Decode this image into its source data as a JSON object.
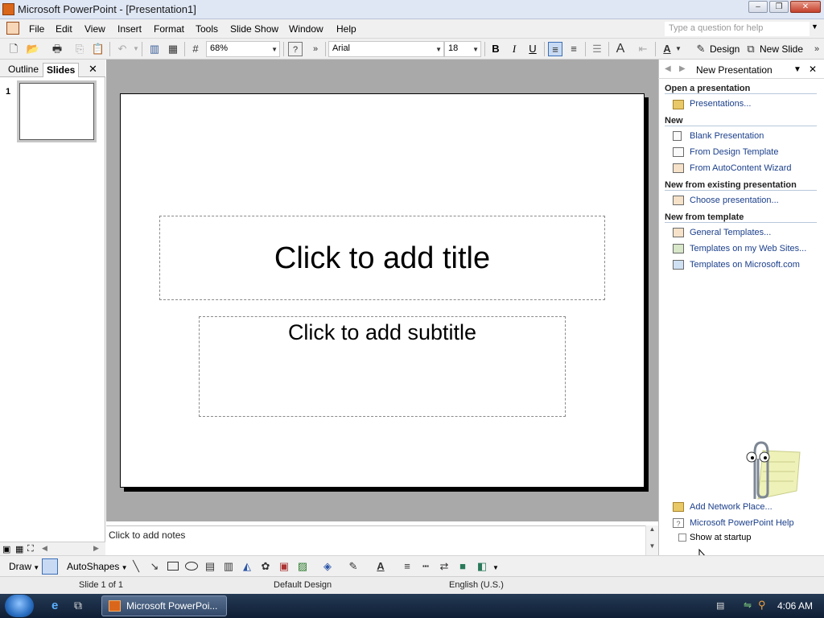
{
  "window": {
    "title": "Microsoft PowerPoint - [Presentation1]",
    "minimize_glyph": "–",
    "restore_glyph": "❐",
    "close_glyph": "✕"
  },
  "menu": {
    "items": [
      "File",
      "Edit",
      "View",
      "Insert",
      "Format",
      "Tools",
      "Slide Show",
      "Window",
      "Help"
    ],
    "ask_placeholder": "Type a question for help"
  },
  "toolbar": {
    "zoom": "68%",
    "font": "Arial",
    "font_size": "18",
    "bold": "B",
    "italic": "I",
    "underline": "U",
    "design_label": "Design",
    "new_slide_label": "New Slide"
  },
  "left_pane": {
    "tabs": [
      "Outline",
      "Slides"
    ],
    "active_tab": "Slides",
    "slide_number": "1"
  },
  "slide": {
    "title_placeholder": "Click to add title",
    "subtitle_placeholder": "Click to add subtitle"
  },
  "notes": {
    "placeholder": "Click to add notes"
  },
  "task_pane": {
    "title": "New Presentation",
    "sections": [
      {
        "heading": "Open a presentation",
        "links": [
          "Presentations..."
        ]
      },
      {
        "heading": "New",
        "links": [
          "Blank Presentation",
          "From Design Template",
          "From AutoContent Wizard"
        ]
      },
      {
        "heading": "New from existing presentation",
        "links": [
          "Choose presentation..."
        ]
      },
      {
        "heading": "New from template",
        "links": [
          "General Templates...",
          "Templates on my Web Sites...",
          "Templates on Microsoft.com"
        ]
      }
    ],
    "bottom_links": [
      "Add Network Place...",
      "Microsoft PowerPoint Help"
    ],
    "show_at_startup": "Show at startup"
  },
  "drawing_toolbar": {
    "draw_label": "Draw",
    "autoshapes_label": "AutoShapes"
  },
  "status_bar": {
    "slide_info": "Slide 1 of 1",
    "design": "Default Design",
    "language": "English (U.S.)"
  },
  "taskbar": {
    "task_label": "Microsoft PowerPoi...",
    "clock": "4:06 AM"
  },
  "colors": {
    "link": "#1b3f8b",
    "slide_area_bg": "#a9a9a9",
    "taskbar": "#1a2c45"
  }
}
